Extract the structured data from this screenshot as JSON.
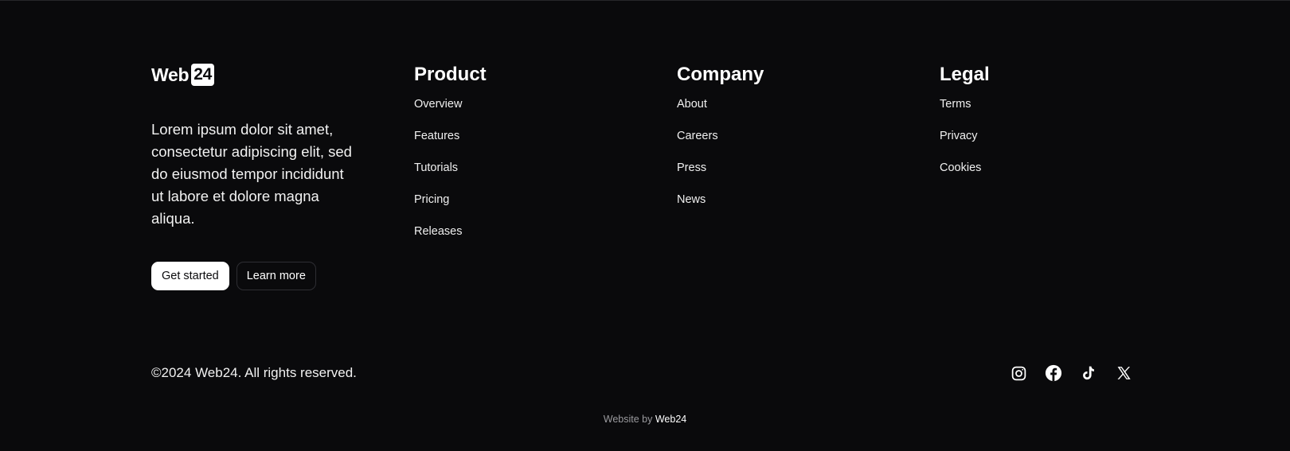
{
  "brand": {
    "name": "Web",
    "badge": "24"
  },
  "blurb": "Lorem ipsum dolor sit amet, consectetur adipiscing elit, sed do eiusmod tempor incididunt ut labore et dolore magna aliqua.",
  "buttons": {
    "primary_label": "Get started",
    "secondary_label": "Learn more"
  },
  "columns": [
    {
      "title": "Product",
      "links": [
        "Overview",
        "Features",
        "Tutorials",
        "Pricing",
        "Releases"
      ]
    },
    {
      "title": "Company",
      "links": [
        "About",
        "Careers",
        "Press",
        "News"
      ]
    },
    {
      "title": "Legal",
      "links": [
        "Terms",
        "Privacy",
        "Cookies"
      ]
    }
  ],
  "copyright": "©2024 Web24. All rights reserved.",
  "socials": [
    {
      "icon": "instagram-icon"
    },
    {
      "icon": "facebook-icon"
    },
    {
      "icon": "tiktok-icon"
    },
    {
      "icon": "x-icon"
    }
  ],
  "credit": {
    "prefix": "Website by",
    "name": "Web24"
  },
  "colors": {
    "background": "#0a0a0c",
    "text": "#ffffff",
    "muted": "#9a9a9e"
  }
}
